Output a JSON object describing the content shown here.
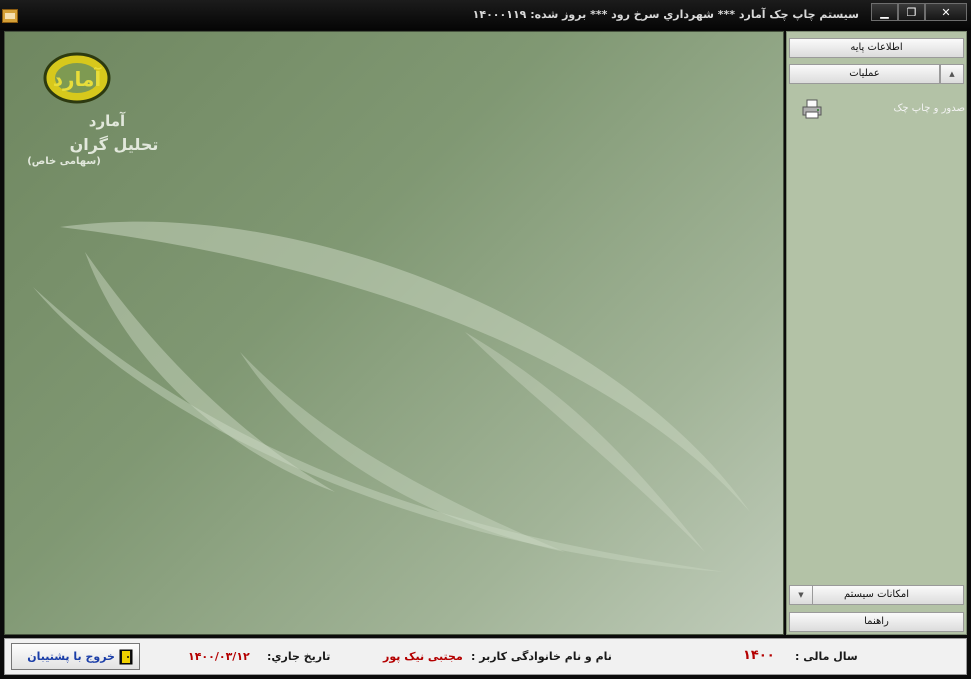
{
  "window": {
    "title": "سیستم چاپ چک آمارد  ***  شهرداري سرخ  رود  *** بروز شده: ۱۴۰۰۰۱۱۹",
    "min_glyph": "▁",
    "max_glyph": "❐",
    "close_glyph": "✕"
  },
  "logo": {
    "mark": "آمارد",
    "line1": "آمارد",
    "line2": "تحلیل گران",
    "line3": "(سهامی خاص)"
  },
  "sidebar": {
    "base_info": "اطلاعات پایه",
    "operations": "عملیات",
    "operations_arrow": "▲",
    "items": [
      {
        "label": "صدور و چاپ چک",
        "icon": "printer-icon"
      }
    ],
    "system": "امکانات سیستم",
    "system_arrow": "▼",
    "help": "راهنما"
  },
  "status": {
    "exit_label": "خروج با پشتیبان",
    "date_label": "تاریخ جاري:",
    "date_value": "۱۴۰۰/۰۳/۱۲",
    "user_label": "نام و نام خانوادگی کاربر :",
    "user_value": "مجتبی نیک پور",
    "year_label": "سال مالی :",
    "year_value": "۱۴۰۰"
  },
  "colors": {
    "accent_red": "#b40000",
    "exit_blue": "#1b3ea8",
    "logo_yellow": "#e6d21a"
  }
}
